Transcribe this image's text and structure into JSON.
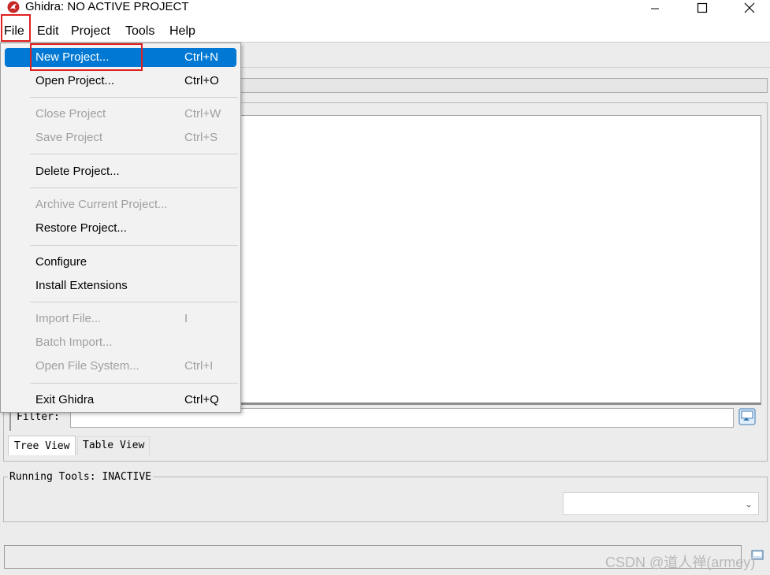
{
  "window": {
    "title": "Ghidra: NO ACTIVE PROJECT",
    "minimize_icon": "minimize-icon",
    "maximize_icon": "maximize-icon",
    "close_icon": "close-icon"
  },
  "menubar": {
    "items": [
      "File",
      "Edit",
      "Project",
      "Tools",
      "Help"
    ],
    "open_menu": "File"
  },
  "file_menu": {
    "items": [
      {
        "label": "New Project...",
        "shortcut": "Ctrl+N",
        "enabled": true,
        "selected": true
      },
      {
        "label": "Open Project...",
        "shortcut": "Ctrl+O",
        "enabled": true
      },
      {
        "label": "Close Project",
        "shortcut": "Ctrl+W",
        "enabled": false
      },
      {
        "label": "Save Project",
        "shortcut": "Ctrl+S",
        "enabled": false
      },
      {
        "label": "Delete Project...",
        "shortcut": "",
        "enabled": true
      },
      {
        "label": "Archive Current Project...",
        "shortcut": "",
        "enabled": false
      },
      {
        "label": "Restore Project...",
        "shortcut": "",
        "enabled": true
      },
      {
        "label": "Configure",
        "shortcut": "",
        "enabled": true
      },
      {
        "label": "Install Extensions",
        "shortcut": "",
        "enabled": true
      },
      {
        "label": "Import File...",
        "shortcut": "I",
        "enabled": false
      },
      {
        "label": "Batch Import...",
        "shortcut": "",
        "enabled": false
      },
      {
        "label": "Open File System...",
        "shortcut": "Ctrl+I",
        "enabled": false
      },
      {
        "label": "Exit Ghidra",
        "shortcut": "Ctrl+Q",
        "enabled": true
      }
    ]
  },
  "project_panel": {
    "filter_label": "Filter:",
    "filter_value": "",
    "tabs": [
      "Tree View",
      "Table View"
    ],
    "active_tab": "Tree View"
  },
  "running_tools": {
    "label": "Running Tools: INACTIVE",
    "selected_tool": ""
  },
  "watermark": "CSDN @道人禅(armey)",
  "colors": {
    "selection": "#0078d4",
    "highlight_box": "#e02020",
    "app_icon": "#c62828"
  }
}
